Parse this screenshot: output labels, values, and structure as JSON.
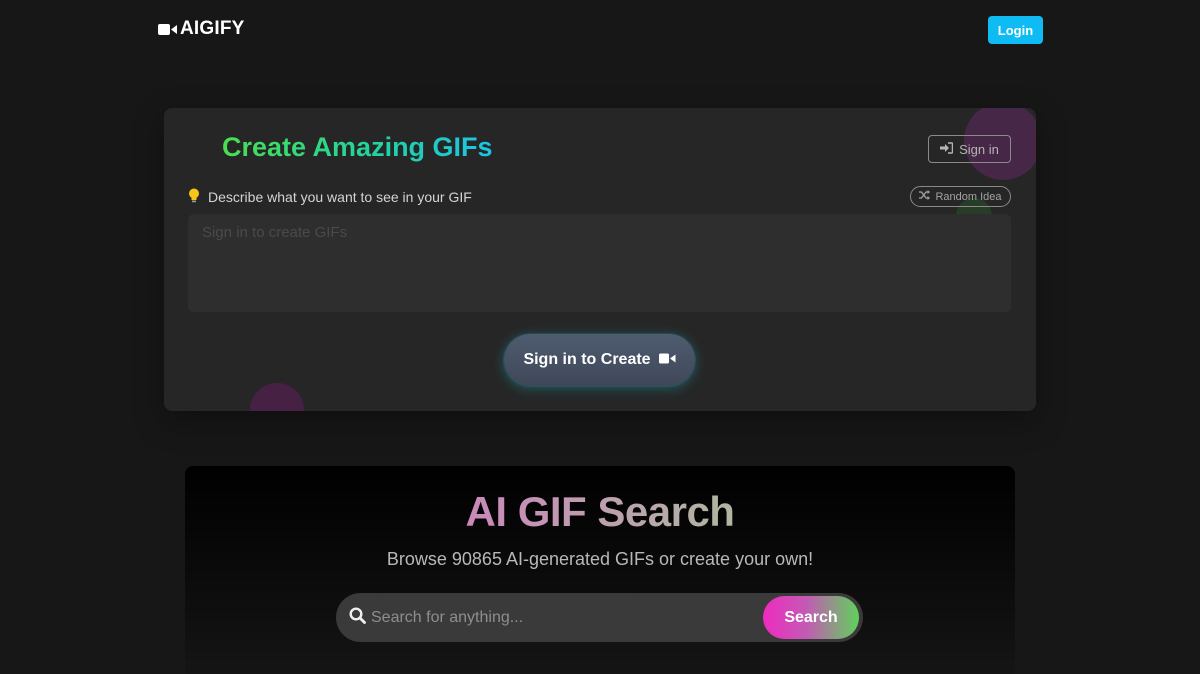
{
  "header": {
    "logo_text": "AIGIFY",
    "logo_icon": "video-camera-icon",
    "login_label": "Login"
  },
  "create": {
    "title": "Create Amazing GIFs",
    "signin_label": "Sign in",
    "signin_icon": "sign-in-icon",
    "prompt_label": "Describe what you want to see in your GIF",
    "prompt_icon": "lightbulb-icon",
    "random_label": "Random Idea",
    "random_icon": "shuffle-icon",
    "prompt_placeholder": "Sign in to create GIFs",
    "create_label": "Sign in to Create",
    "create_icon": "video-camera-icon"
  },
  "search": {
    "title": "AI GIF Search",
    "subtitle": "Browse 90865 AI-generated GIFs or create your own!",
    "placeholder": "Search for anything...",
    "button_label": "Search",
    "icon": "search-icon"
  },
  "colors": {
    "login_bg": "#0ebbf2",
    "title_gradient_start": "#4ade50",
    "title_gradient_end": "#1cc4e6",
    "search_btn_start": "#ee2bc0",
    "search_btn_end": "#5fd25a"
  }
}
